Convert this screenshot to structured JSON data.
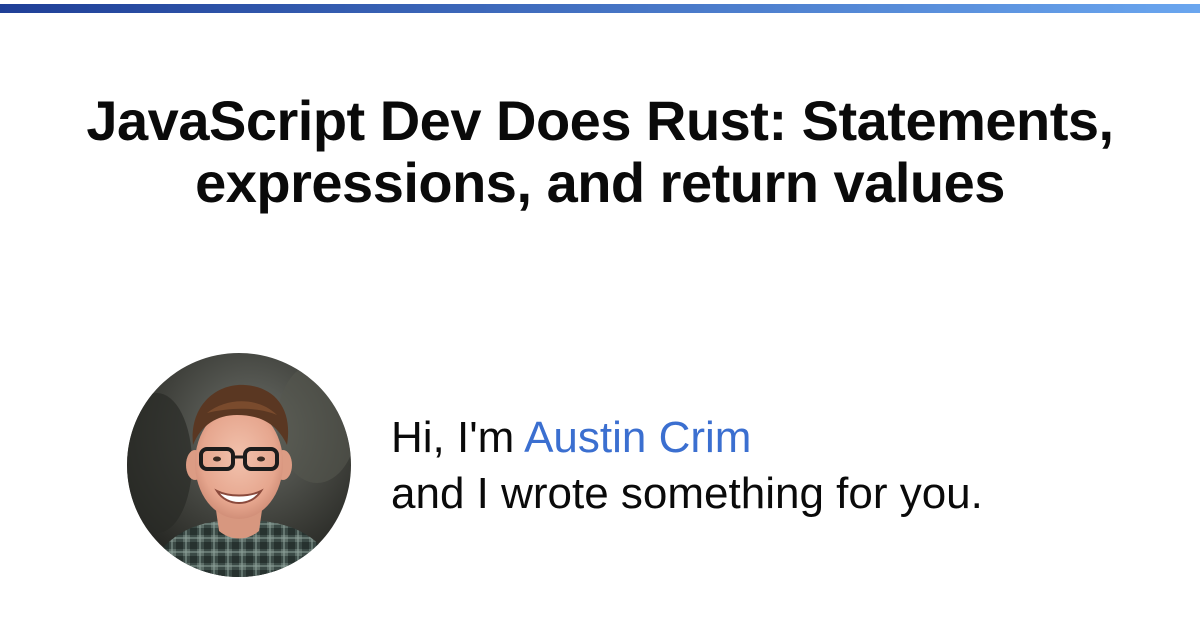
{
  "colors": {
    "accent": "#3b6fd0",
    "top_bar_gradient_start": "#1f3f97",
    "top_bar_gradient_end": "#6aa6ef"
  },
  "title": {
    "line1": "JavaScript Dev Does Rust: Statements,",
    "line2": "expressions, and return values"
  },
  "author": {
    "greeting": "Hi, I'm",
    "name": "Austin Crim",
    "tagline": "and I wrote something for you."
  },
  "avatar": {
    "icon": "author-photo"
  }
}
